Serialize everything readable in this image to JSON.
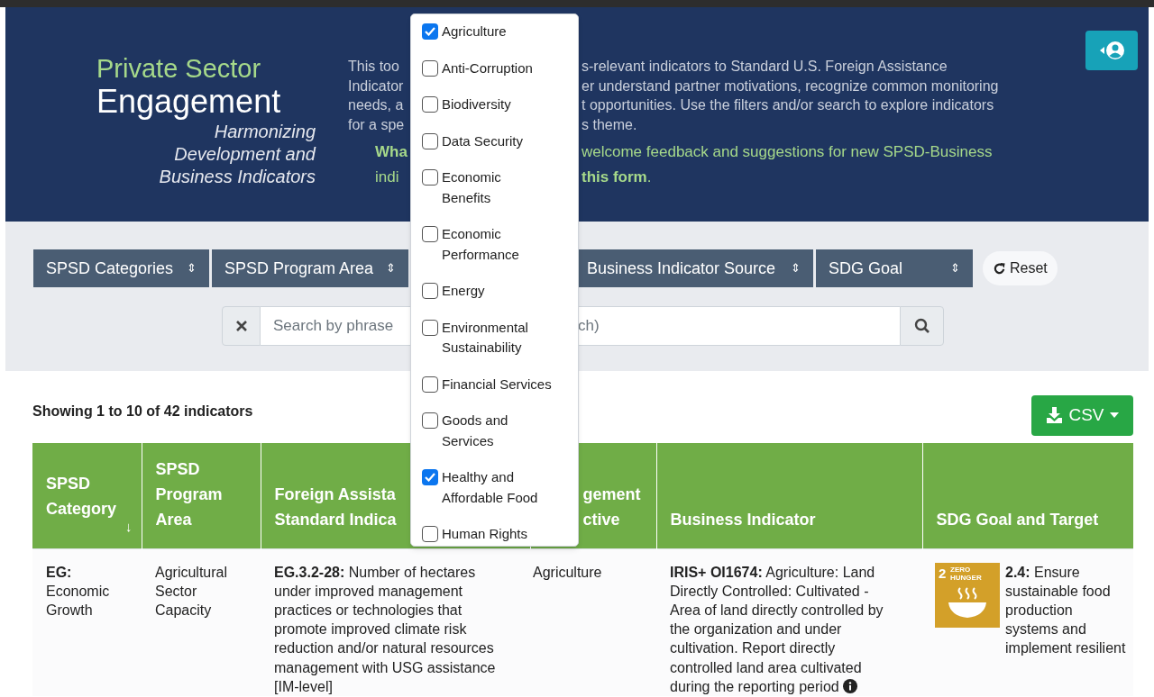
{
  "header": {
    "title_top": "Private Sector",
    "title_main": "Engagement",
    "tagline": "Harmonizing Development and Business Indicators",
    "intro_left": [
      "This too",
      "Indicator",
      "needs, a",
      "for a spe"
    ],
    "intro_right": [
      "s-relevant indicators to Standard U.S. Foreign Assistance",
      "er understand partner motivations, recognize common monitoring",
      "t opportunities. Use the filters and/or search to explore indicators",
      "s theme."
    ],
    "feedback_left": [
      "**Wha**",
      "indi"
    ],
    "feedback_right": [
      "welcome feedback and suggestions for new SPSD-Business",
      "**this form**."
    ]
  },
  "filters": [
    {
      "label": "SPSD Categories",
      "arrow": "⇕"
    },
    {
      "label": "SPSD Program Area",
      "arrow": "⇕"
    },
    {
      "label": "Business Indicator Source",
      "arrow": "⇕"
    },
    {
      "label": "SDG Goal",
      "arrow": "⇕"
    }
  ],
  "reset": "Reset",
  "search": {
    "placeholder": "Search by phrase",
    "placeholder_tail": "ch)"
  },
  "summary": "Showing 1 to 10 of 42 indicators",
  "export": "CSV",
  "table": {
    "columns": [
      {
        "label": "SPSD\nCategory",
        "sort": "↓"
      },
      {
        "label": "SPSD\nProgram\nArea"
      },
      {
        "label": "Foreign Assista\nStandard Indica"
      },
      {
        "label": "gement\nctive"
      },
      {
        "label": "Business Indicator"
      },
      {
        "label": "SDG Goal and Target"
      }
    ],
    "rows": [
      {
        "category": "**EG:**\nEconomic\nGrowth",
        "program_area": "Agricultural Sector Capacity",
        "fa_indicator": "**EG.3.2-28:** Number of hectares under improved management practices or technologies that promote improved climate risk reduction and/or natural resources management with USG assistance [IM-level]",
        "column_4": "Agriculture",
        "business_indicator": "**IRIS+ OI1674:** Agriculture: Land Directly Controlled: Cultivated - Area of land directly controlled by the organization and under cultivation. Report directly controlled land area cultivated during the reporting period",
        "sdg_badge": {
          "number": "2",
          "label": "ZERO HUNGER"
        },
        "sdg_target": "**2.4:** Ensure sustainable food production systems and implement resilient"
      }
    ]
  },
  "dropdown": [
    {
      "label": "Agriculture",
      "checked": true
    },
    {
      "label": "Anti-Corruption",
      "checked": false
    },
    {
      "label": "Biodiversity",
      "checked": false
    },
    {
      "label": "Data Security",
      "checked": false
    },
    {
      "label": "Economic Benefits",
      "checked": false
    },
    {
      "label": "Economic Performance",
      "checked": false
    },
    {
      "label": "Energy",
      "checked": false
    },
    {
      "label": "Environmental Sustainability",
      "checked": false
    },
    {
      "label": "Financial Services",
      "checked": false
    },
    {
      "label": "Goods and Services",
      "checked": false
    },
    {
      "label": "Healthy and Affordable Food",
      "checked": true
    },
    {
      "label": "Human Rights",
      "checked": false
    }
  ]
}
